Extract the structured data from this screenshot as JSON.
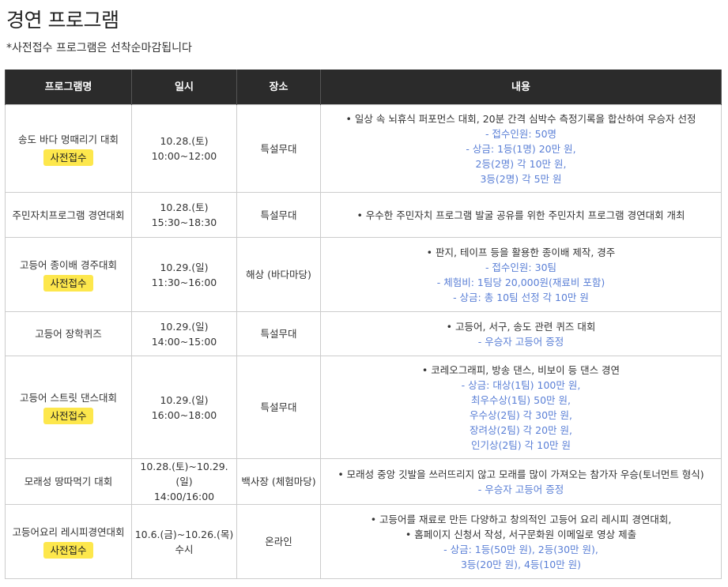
{
  "page": {
    "title": "경연 프로그램",
    "notice": "*사전접수 프로그램은 선착순마감됩니다"
  },
  "table": {
    "headers": [
      "프로그램명",
      "일시",
      "장소",
      "내용"
    ],
    "badge_label": "사전접수",
    "rows": [
      {
        "name": "송도 바다 멍때리기 대회",
        "date": "10.28.(토)",
        "time": "10:00~12:00",
        "place": "특설무대",
        "desc_main": [
          "• 일상 속 뇌휴식 퍼포먼스 대회, 20분 간격 심박수 측정기록을 합산하여 우승자 선정"
        ],
        "desc_sub": [
          "- 접수인원: 50명",
          "- 상금: 1등(1명) 20만 원,",
          "2등(2명) 각 10만 원,",
          "3등(2명) 각 5만 원"
        ]
      },
      {
        "name": "주민자치프로그램 경연대회",
        "date": "10.28.(토)",
        "time": "15:30~18:30",
        "place": "특설무대",
        "desc_main": [
          "• 우수한 주민자치 프로그램 발굴 공유를 위한 주민자치 프로그램 경연대회 개최"
        ],
        "desc_sub": []
      },
      {
        "name": "고등어 종이배 경주대회",
        "date": "10.29.(일)",
        "time": "11:30~16:00",
        "place": "해상 (바다마당)",
        "desc_main": [
          "• 판지, 테이프 등을 활용한 종이배 제작, 경주"
        ],
        "desc_sub": [
          "- 접수인원: 30팀",
          "- 체험비: 1팀당 20,000원(재료비 포함)",
          "- 상금: 총 10팀 선정 각 10만 원"
        ]
      },
      {
        "name": "고등어 장학퀴즈",
        "date": "10.29.(일)",
        "time": "14:00~15:00",
        "place": "특설무대",
        "desc_main": [
          "• 고등어, 서구, 송도 관련 퀴즈 대회"
        ],
        "desc_sub": [
          "- 우승자 고등어 증정"
        ]
      },
      {
        "name": "고등어 스트릿 댄스대회",
        "date": "10.29.(일)",
        "time": "16:00~18:00",
        "place": "특설무대",
        "desc_main": [
          "• 코레오그래피, 방송 댄스, 비보이 등 댄스 경연"
        ],
        "desc_sub": [
          "- 상금: 대상(1팀) 100만 원,",
          "최우수상(1팀) 50만 원,",
          "우수상(2팀) 각 30만 원,",
          "장려상(2팀) 각 20만 원,",
          "인기상(2팀) 각 10만 원"
        ]
      },
      {
        "name": "모래성 땅따먹기 대회",
        "date": "10.28.(토)~10.29.(일)",
        "time": "14:00/16:00",
        "place": "백사장 (체험마당)",
        "desc_main": [
          "• 모래성 중앙 깃발을 쓰러뜨리지 않고 모래를 많이 가져오는 참가자 우승(토너먼트 형식)"
        ],
        "desc_sub": [
          "- 우승자 고등어 증정"
        ]
      },
      {
        "name": "고등어요리 레시피경연대회",
        "date": "10.6.(금)~10.26.(목)",
        "time": "수시",
        "place": "온라인",
        "desc_main": [
          "• 고등어를 재료로 만든 다양하고 창의적인 고등어 요리 레시피 경연대회,",
          "• 홈페이지 신청서 작성, 서구문화원 이메일로 영상 제출"
        ],
        "desc_sub": [
          "- 상금: 1등(50만 원), 2등(30만 원),",
          "3등(20만 원), 4등(10만 원)"
        ]
      }
    ]
  },
  "colors": {
    "header_bg": "#2b2b2b",
    "badge_bg": "#fde74c",
    "accent_text": "#5a7fd6"
  }
}
